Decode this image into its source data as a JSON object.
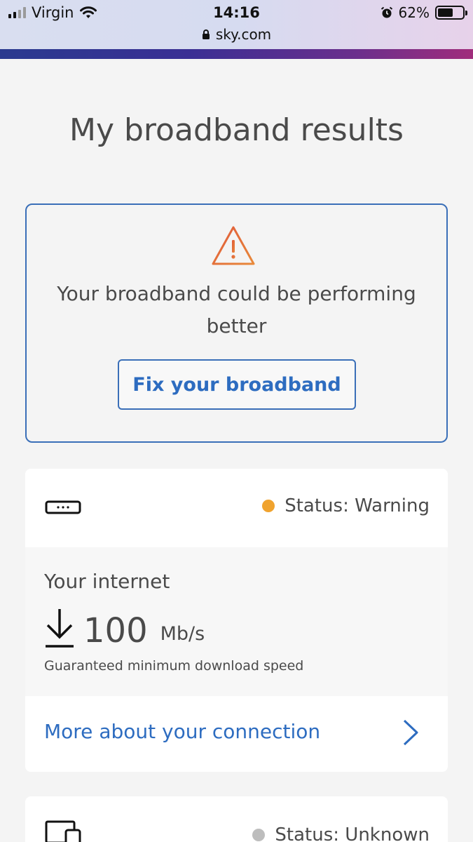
{
  "statusbar": {
    "carrier": "Virgin",
    "time": "14:16",
    "url": "sky.com",
    "battery": "62%",
    "battery_level": 0.62
  },
  "page": {
    "title": "My broadband results"
  },
  "alert": {
    "message": "Your broadband could be performing better",
    "button_label": "Fix your broadband",
    "accent": "#e0703a"
  },
  "internet": {
    "status": "Status: Warning",
    "status_color": "#f0a32e",
    "label": "Your internet",
    "speed_value": "100",
    "speed_unit": "Mb/s",
    "speed_note": "Guaranteed minimum download speed",
    "more_link": "More about your connection"
  },
  "devices": {
    "status": "Status: Unknown",
    "status_color": "#bdbdbd"
  },
  "colors": {
    "link": "#2d6cc0",
    "border": "#3a6fb8"
  }
}
